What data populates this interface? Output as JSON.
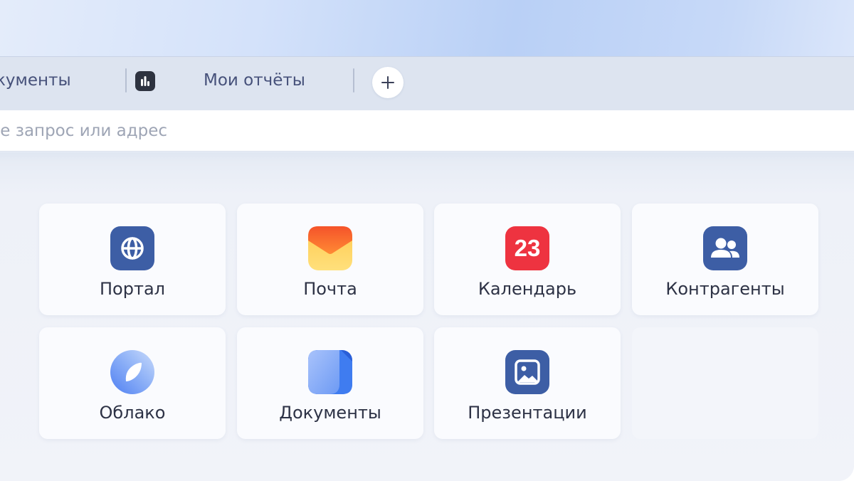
{
  "tabs": [
    {
      "label": "кументы",
      "icon": "doc-tab"
    },
    {
      "label": "Мои отчёты",
      "icon": "bar-chart-icon"
    }
  ],
  "new_tab": {
    "icon": "plus-icon"
  },
  "omnibox": {
    "placeholder": "дите запрос или адрес"
  },
  "colors": {
    "tab_text": "#46517a",
    "tile_label": "#2d3245",
    "portal": "#3d5ea5",
    "mail_top": "#f25c2c",
    "mail_bottom": "#ffd45a",
    "calendar": "#ee3340",
    "contacts": "#3d5ea5",
    "cloud": "#6d9cf5",
    "docs": "#3f7cf0",
    "presentations": "#3d5ea5"
  },
  "tiles": [
    {
      "label": "Портал",
      "icon": "globe-icon"
    },
    {
      "label": "Почта",
      "icon": "mail-icon"
    },
    {
      "label": "Календарь",
      "icon": "calendar-icon",
      "badge": "23"
    },
    {
      "label": "Контрагенты",
      "icon": "contacts-icon"
    },
    {
      "label": "Облако",
      "icon": "cloud-icon"
    },
    {
      "label": "Документы",
      "icon": "documents-icon"
    },
    {
      "label": "Презентации",
      "icon": "presentation-icon"
    }
  ]
}
